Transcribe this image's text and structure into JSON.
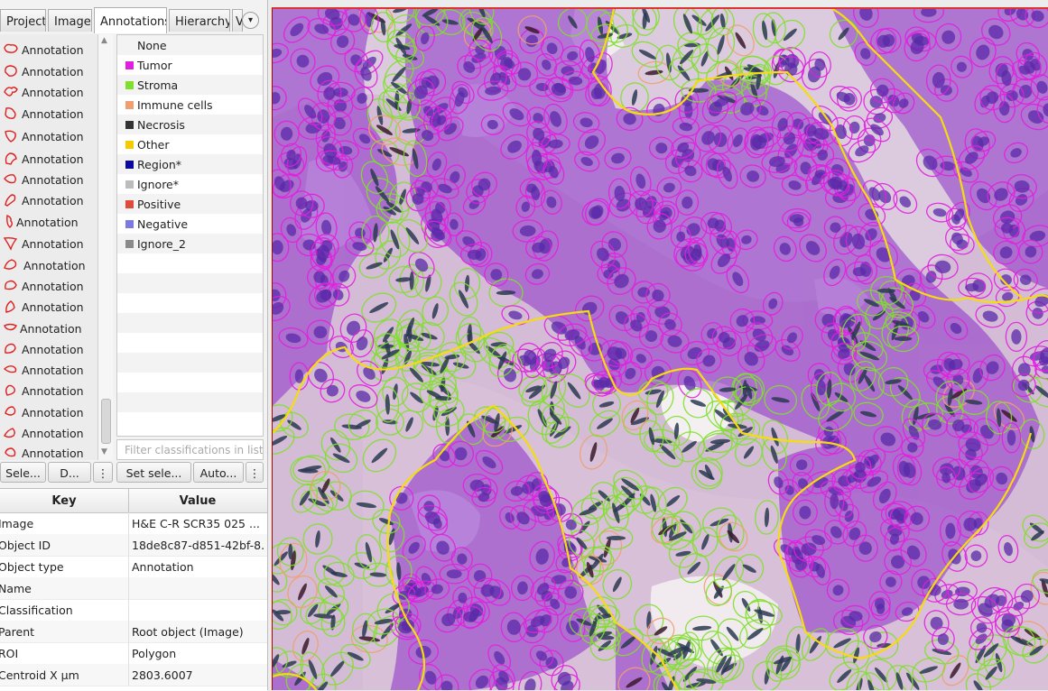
{
  "tabs": [
    "Project",
    "Image",
    "Annotations",
    "Hierarchy",
    "V"
  ],
  "annotations": [
    "Annotation",
    "Annotation",
    "Annotation",
    "Annotation",
    "Annotation",
    "Annotation",
    "Annotation",
    "Annotation",
    "Annotation",
    "Annotation",
    "Annotation",
    "Annotation",
    "Annotation",
    "Annotation",
    "Annotation",
    "Annotation",
    "Annotation",
    "Annotation",
    "Annotation",
    "Annotation"
  ],
  "classes": [
    {
      "name": "None",
      "color": ""
    },
    {
      "name": "Tumor",
      "color": "#e020e0"
    },
    {
      "name": "Stroma",
      "color": "#7ee02a"
    },
    {
      "name": "Immune cells",
      "color": "#f0a070"
    },
    {
      "name": "Necrosis",
      "color": "#333333"
    },
    {
      "name": "Other",
      "color": "#f2cc00"
    },
    {
      "name": "Region*",
      "color": "#0a0aa0"
    },
    {
      "name": "Ignore*",
      "color": "#bcbcbc"
    },
    {
      "name": "Positive",
      "color": "#e04a3a"
    },
    {
      "name": "Negative",
      "color": "#7a7ae0"
    },
    {
      "name": "Ignore_2",
      "color": "#8a8a8a"
    }
  ],
  "filter_placeholder": "Filter classifications in list",
  "buttons": {
    "select": "Sele...",
    "delete": "D...",
    "more1": "⋮",
    "set_selected": "Set sele...",
    "auto": "Auto...",
    "more2": "⋮"
  },
  "properties": {
    "key_header": "Key",
    "value_header": "Value",
    "rows": [
      {
        "key": "Image",
        "value": "H&E C-R SCR35 025 ..."
      },
      {
        "key": "Object ID",
        "value": "18de8c87-d851-42bf-8..."
      },
      {
        "key": "Object type",
        "value": "Annotation"
      },
      {
        "key": "Name",
        "value": ""
      },
      {
        "key": "Classification",
        "value": ""
      },
      {
        "key": "Parent",
        "value": "Root object (Image)"
      },
      {
        "key": "ROI",
        "value": "Polygon"
      },
      {
        "key": "Centroid X µm",
        "value": "2803.6007"
      }
    ]
  },
  "colors": {
    "tumor": "#e020e0",
    "stroma": "#7ee02a",
    "other_boundary": "#f2d200",
    "immune": "#f0a070"
  }
}
